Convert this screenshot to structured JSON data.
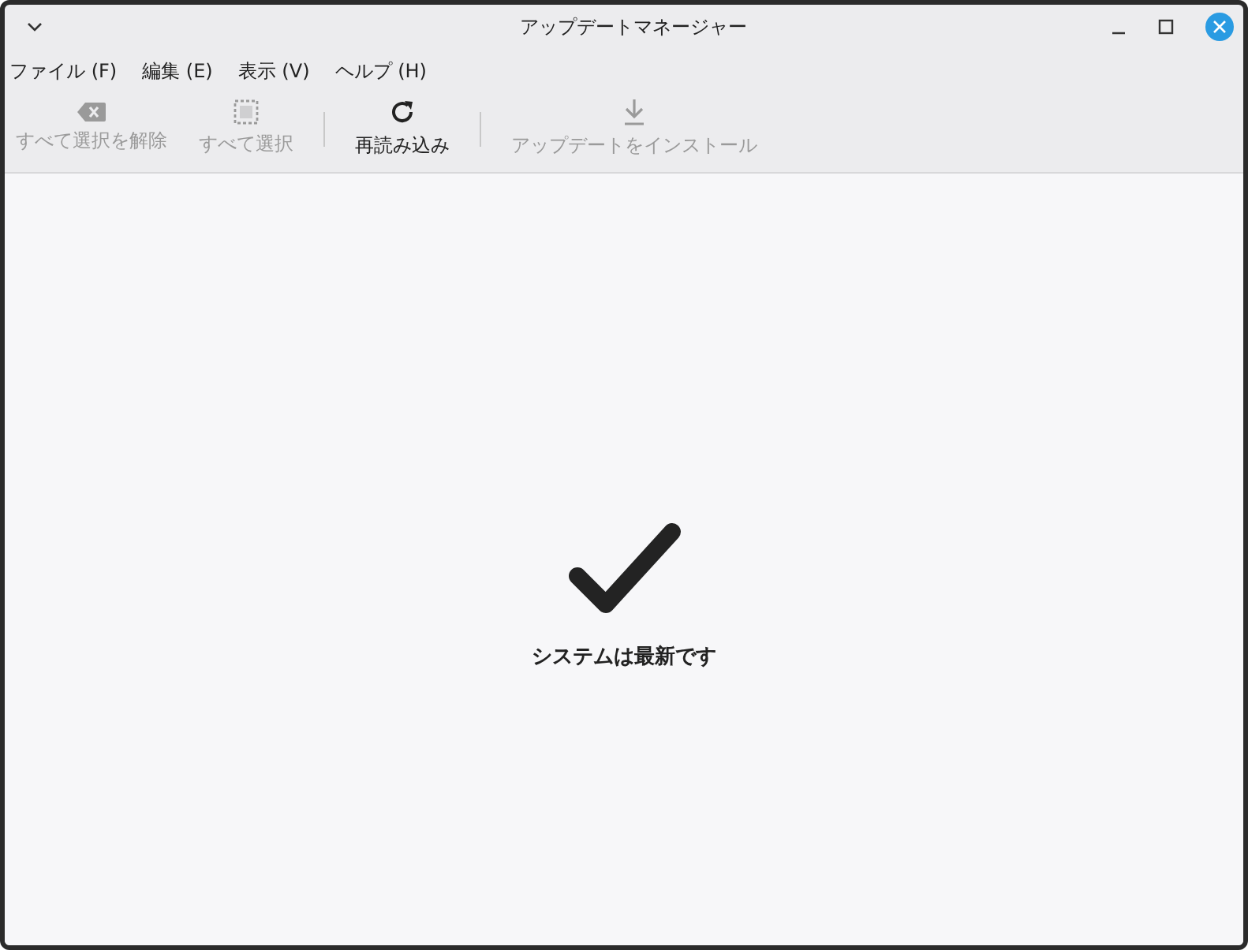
{
  "window": {
    "title": "アップデートマネージャー"
  },
  "menu": [
    {
      "label": "ファイル (F)"
    },
    {
      "label": "編集 (E)"
    },
    {
      "label": "表示 (V)"
    },
    {
      "label": "ヘルプ (H)"
    }
  ],
  "toolbar": {
    "groups": [
      {
        "items": [
          {
            "kind": "clear",
            "label": "すべて選択を解除",
            "disabled": true
          },
          {
            "kind": "selectall",
            "label": "すべて選択",
            "disabled": true
          }
        ]
      },
      {
        "items": [
          {
            "kind": "reload",
            "label": "再読み込み",
            "disabled": false
          }
        ]
      },
      {
        "items": [
          {
            "kind": "install",
            "label": "アップデートをインストール",
            "disabled": true
          }
        ]
      }
    ]
  },
  "status": {
    "message": "システムは最新です"
  }
}
